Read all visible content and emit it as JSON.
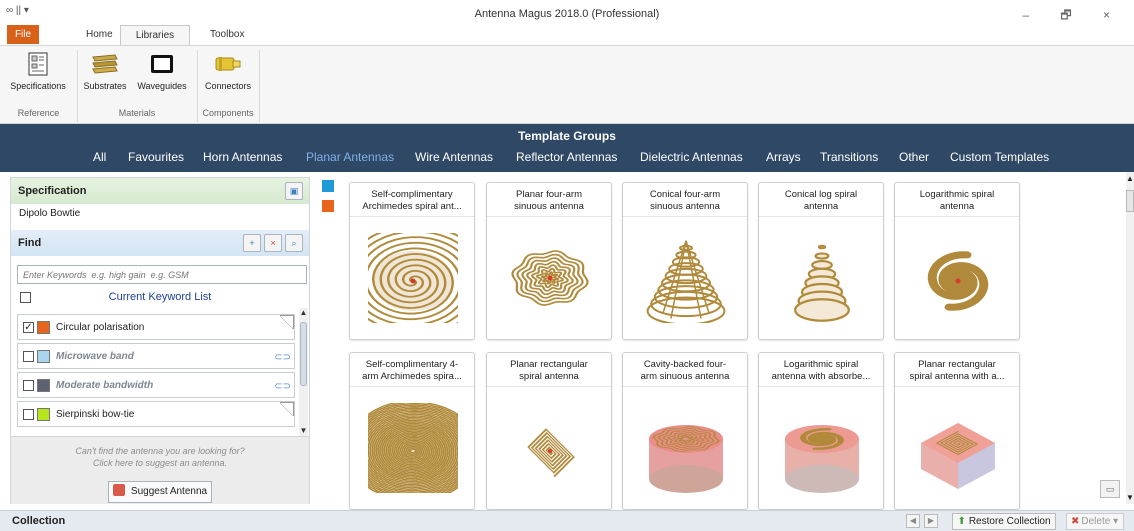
{
  "app": {
    "quick_access": "∞ || ▾",
    "title": "Antenna Magus 2018.0 (Professional)",
    "window_buttons": "–  🗗  ×"
  },
  "ribbon": {
    "tabs": {
      "file": "File",
      "home": "Home",
      "libraries": "Libraries",
      "toolbox": "Toolbox"
    },
    "buttons": {
      "specifications": "Specifications",
      "substrates": "Substrates",
      "waveguides": "Waveguides",
      "connectors": "Connectors"
    },
    "groups": {
      "reference": "Reference",
      "materials": "Materials",
      "components": "Components"
    }
  },
  "template_groups": {
    "header": "Template Groups",
    "items": [
      "All",
      "Favourites",
      "Horn Antennas",
      "Planar Antennas",
      "Wire Antennas",
      "Reflector Antennas",
      "Dielectric Antennas",
      "Arrays",
      "Transitions",
      "Other",
      "Custom Templates"
    ],
    "active": "Planar Antennas",
    "active_color": "#7fb0e6"
  },
  "left_panel": {
    "specification": {
      "header": "Specification",
      "value": "Dipolo Bowtie"
    },
    "find": {
      "header": "Find",
      "placeholder": "Enter Keywords  e.g. high gain  e.g. GSM",
      "keyword_list_label": "Current Keyword List",
      "keywords": [
        {
          "label": "Circular polarisation",
          "checked": true,
          "color": "#e8651e",
          "style": "normal"
        },
        {
          "label": "Microwave band",
          "checked": false,
          "color": "#a9d6ec",
          "style": "inactive"
        },
        {
          "label": "Moderate bandwidth",
          "checked": false,
          "color": "#5c6270",
          "style": "inactive"
        },
        {
          "label": "Sierpinski bow-tie",
          "checked": false,
          "color": "#b6e61c",
          "style": "normal"
        }
      ]
    },
    "suggest": {
      "line1": "Can't find the antenna you are looking for?",
      "line2": "Click here to suggest an antenna.",
      "button": "Suggest Antenna"
    }
  },
  "catalog": {
    "swatches": [
      "#1e9ad6",
      "#e8651e"
    ],
    "cards": [
      {
        "title1": "Self-complimentary",
        "title2": "Archimedes spiral ant...",
        "art": "archimedes"
      },
      {
        "title1": "Planar four-arm",
        "title2": "sinuous antenna",
        "art": "sinuous"
      },
      {
        "title1": "Conical four-arm",
        "title2": "sinuous antenna",
        "art": "cone"
      },
      {
        "title1": "Conical log spiral",
        "title2": "antenna",
        "art": "conelog"
      },
      {
        "title1": "Logarithmic spiral",
        "title2": "antenna",
        "art": "logspiral"
      },
      {
        "title1": "Self-complimentary 4-",
        "title2": "arm Archimedes spira...",
        "art": "archimedes4"
      },
      {
        "title1": "Planar rectangular",
        "title2": "spiral antenna",
        "art": "rectspiral"
      },
      {
        "title1": "Cavity-backed four-",
        "title2": "arm sinuous antenna",
        "art": "cavity"
      },
      {
        "title1": "Logarithmic spiral",
        "title2": "antenna with absorbe...",
        "art": "logabs"
      },
      {
        "title1": "Planar rectangular",
        "title2": "spiral antenna with a...",
        "art": "rectcube"
      }
    ]
  },
  "collection": {
    "label": "Collection",
    "prev": "◀",
    "next": "▶",
    "restore": "Restore Collection",
    "delete": "Delete"
  }
}
